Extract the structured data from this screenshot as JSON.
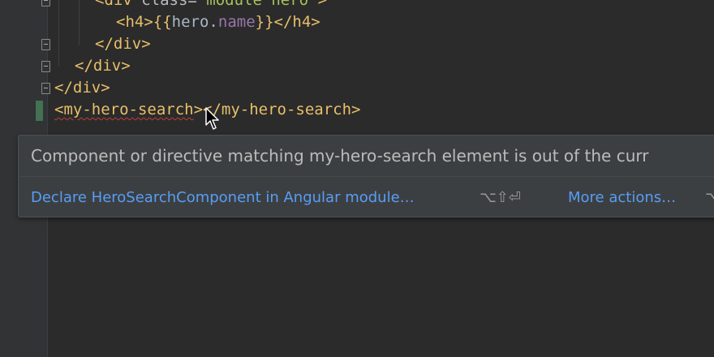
{
  "editor": {
    "lines": [
      {
        "id": "div-module-hero",
        "open": "<div ",
        "attr": "class=",
        "value": "\"module hero\"",
        "close": ">"
      },
      {
        "id": "h4-hero-name",
        "open": "<h4>",
        "brace_open": "{{",
        "obj": "hero",
        "dot": ".",
        "prop": "name",
        "brace_close": "}}",
        "close": "</h4>"
      },
      {
        "id": "close-div-1",
        "text": "</div>"
      },
      {
        "id": "close-div-2",
        "text": "</div>"
      },
      {
        "id": "close-div-3",
        "text": "</div>"
      },
      {
        "id": "hero-search",
        "open": "<my-hero-search",
        "close": "></my-hero-search>"
      }
    ]
  },
  "inspection_popup": {
    "message": "Component or directive matching my-hero-search element is out of the curr",
    "quick_fix_label": "Declare HeroSearchComponent in Angular module…",
    "quick_fix_shortcut": "⌥⇧⏎",
    "more_actions_label": "More actions…",
    "more_actions_shortcut": "⌥"
  },
  "colors": {
    "background": "#2b2b2b",
    "gutter": "#313335",
    "tag": "#e8bf6a",
    "string": "#a5c25c",
    "link": "#589df6",
    "error_underline": "#bc3f3c",
    "change_marker": "#447152"
  }
}
